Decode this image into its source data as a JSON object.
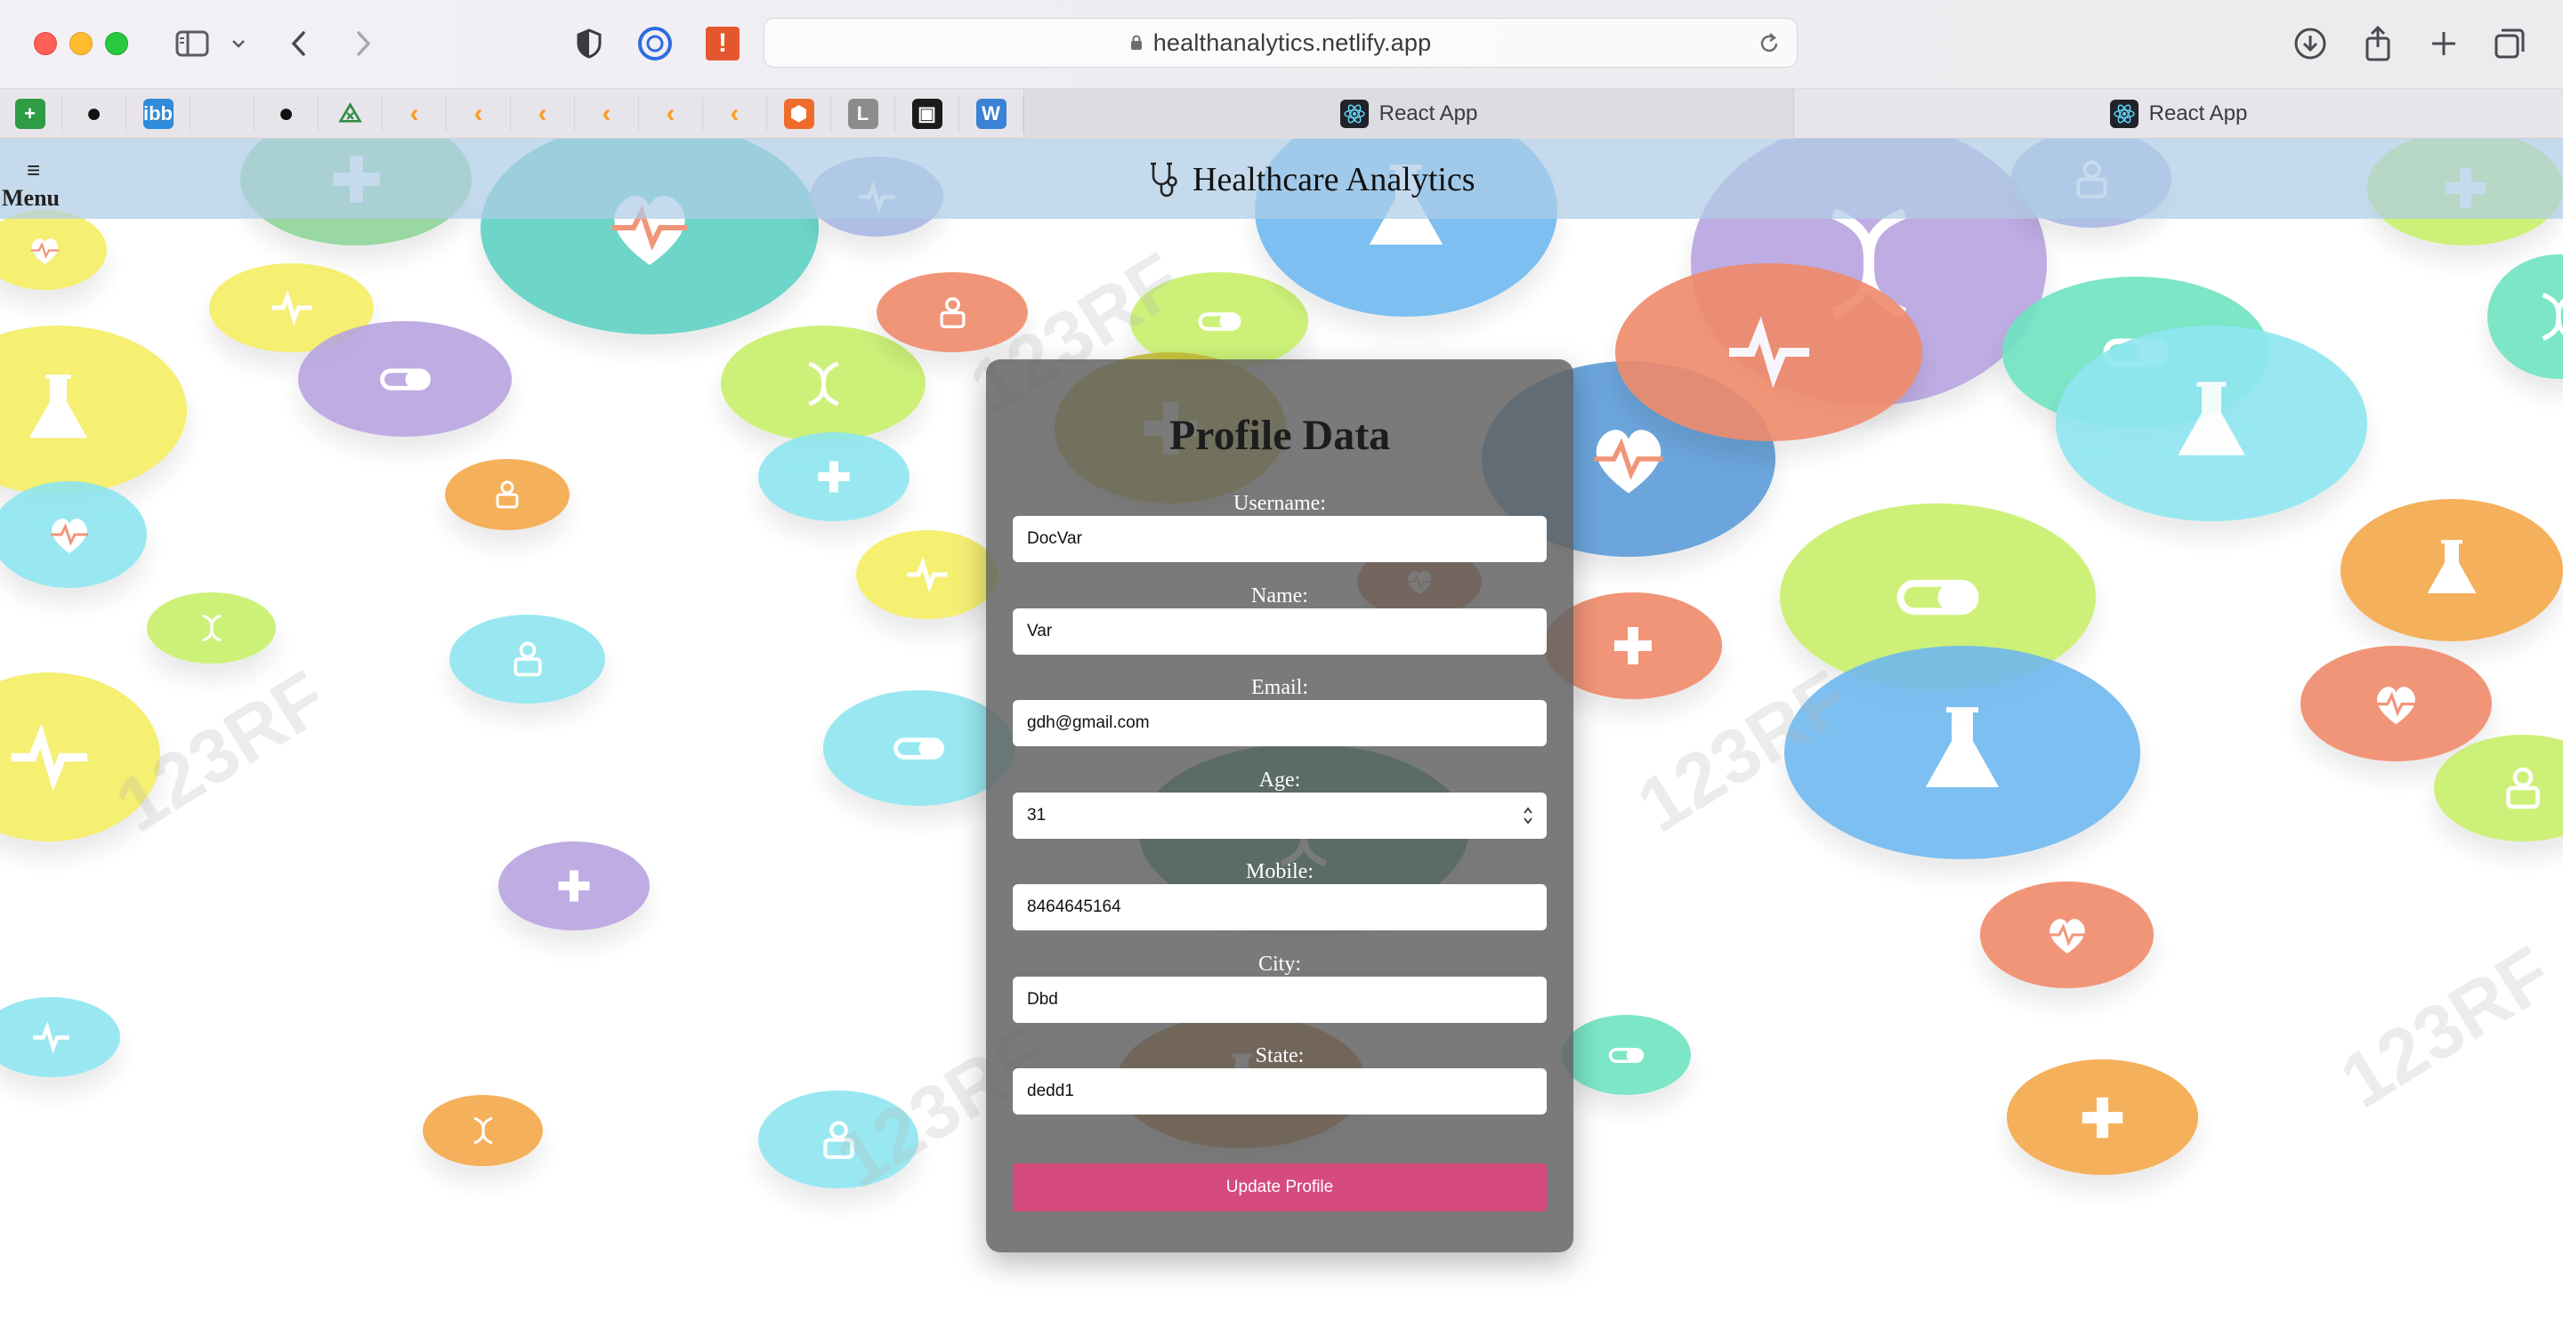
{
  "browser": {
    "url": "healthanalytics.netlify.app",
    "tabs": [
      {
        "label": "React App",
        "active": true
      },
      {
        "label": "React App",
        "active": false
      }
    ],
    "bookmarks": [
      {
        "icon": "green-plus-icon",
        "color": "#2e9b45"
      },
      {
        "icon": "github-icon",
        "color": "#111111"
      },
      {
        "icon": "ibb-icon",
        "color": "#2f8bd9",
        "text": "ibb"
      },
      {
        "icon": "microsoft-icon",
        "color": "#f25022"
      },
      {
        "icon": "github-icon",
        "color": "#111111"
      },
      {
        "icon": "geeksforgeeks-icon",
        "color": "#2f8d46",
        "text": "⨻"
      },
      {
        "icon": "leetcode-icon",
        "color": "#f89f1b"
      },
      {
        "icon": "leetcode-icon",
        "color": "#f89f1b"
      },
      {
        "icon": "leetcode-icon",
        "color": "#f89f1b"
      },
      {
        "icon": "leetcode-icon",
        "color": "#f89f1b"
      },
      {
        "icon": "leetcode-icon",
        "color": "#f89f1b"
      },
      {
        "icon": "leetcode-icon",
        "color": "#f89f1b"
      },
      {
        "icon": "hex-icon",
        "color": "#ef6b2b"
      },
      {
        "icon": "l-icon",
        "color": "#8c8c8c",
        "text": "L"
      },
      {
        "icon": "dark-app-icon",
        "color": "#1b1b1b"
      },
      {
        "icon": "w-icon",
        "color": "#3b82d6",
        "text": "W"
      }
    ]
  },
  "header": {
    "menu_label": "Menu",
    "menu_icon": "≡",
    "brand_title": "Healthcare Analytics",
    "brand_icon": "stethoscope-icon",
    "background": "#afcde6"
  },
  "profile": {
    "title": "Profile Data",
    "fields": [
      {
        "label": "Username:",
        "value": "DocVar"
      },
      {
        "label": "Name:",
        "value": "Var"
      },
      {
        "label": "Email:",
        "value": "gdh@gmail.com"
      },
      {
        "label": "Age:",
        "value": "31"
      },
      {
        "label": "Mobile:",
        "value": "8464645164"
      },
      {
        "label": "City:",
        "value": "Dbd"
      },
      {
        "label": "State:",
        "value": "dedd1"
      }
    ],
    "submit_label": "Update Profile",
    "submit_color": "#d54b7e"
  },
  "watermark": "123RF"
}
